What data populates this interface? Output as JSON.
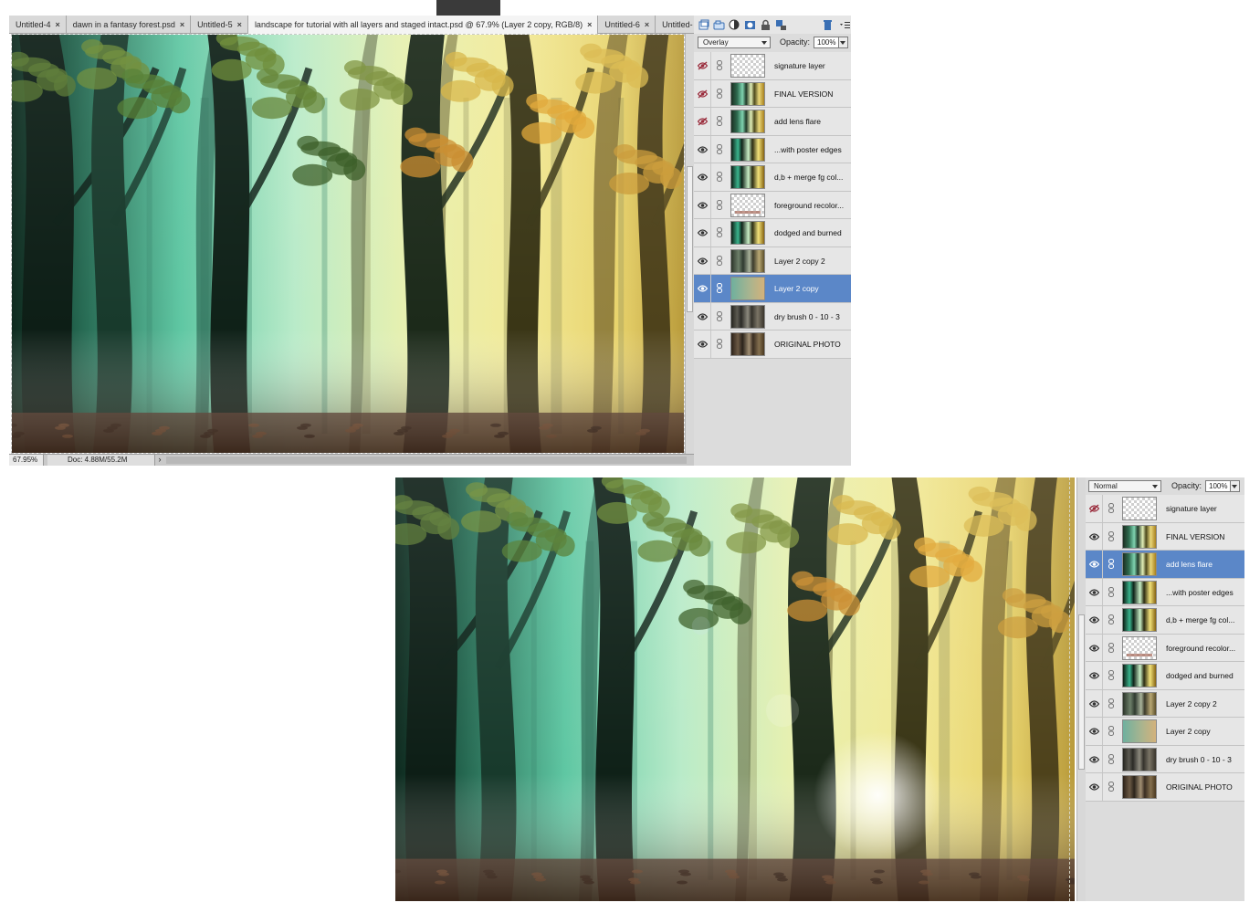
{
  "top_window": {
    "tabs": [
      {
        "label": "Untitled-4",
        "active": false,
        "closable": true
      },
      {
        "label": "dawn in a fantasy forest.psd",
        "active": false,
        "closable": true
      },
      {
        "label": "Untitled-5",
        "active": false,
        "closable": true
      },
      {
        "label": "landscape for tutorial with all layers and staged intact.psd @ 67.9% (Layer 2 copy, RGB/8)",
        "active": true,
        "closable": true
      },
      {
        "label": "Untitled-6",
        "active": false,
        "closable": true
      },
      {
        "label": "Untitled-",
        "active": false,
        "closable": false
      }
    ],
    "tab_overflow": "»",
    "close_glyph": "×",
    "status": {
      "zoom": "67.95%",
      "doc": "Doc: 4.88M/55.2M",
      "arrow": "›"
    },
    "image_brightness": 0.5,
    "layers_panel": {
      "blend_mode": "Overlay",
      "opacity_label": "Opacity:",
      "opacity_value": "100%",
      "toolbar_icons": [
        "new-layer-icon",
        "group-icon",
        "adjustment-icon",
        "mask-icon",
        "lock-icon",
        "lock-pixels-icon",
        "trash-icon",
        "panel-menu-icon"
      ],
      "layers": [
        {
          "name": "signature layer",
          "visible": false,
          "selected": false,
          "thumb": "check"
        },
        {
          "name": "FINAL VERSION",
          "visible": false,
          "selected": false,
          "thumb": "forest"
        },
        {
          "name": "add lens flare",
          "visible": false,
          "selected": false,
          "thumb": "forest"
        },
        {
          "name": "...with poster edges",
          "visible": true,
          "selected": false,
          "thumb": "poster"
        },
        {
          "name": "d,b + merge fg col...",
          "visible": true,
          "selected": false,
          "thumb": "poster"
        },
        {
          "name": "foreground recolor...",
          "visible": true,
          "selected": false,
          "thumb": "check-stain"
        },
        {
          "name": "dodged and burned",
          "visible": true,
          "selected": false,
          "thumb": "poster"
        },
        {
          "name": "Layer 2 copy 2",
          "visible": true,
          "selected": false,
          "thumb": "muted"
        },
        {
          "name": "Layer 2 copy",
          "visible": true,
          "selected": true,
          "thumb": "gradient"
        },
        {
          "name": "dry brush 0 - 10 - 3",
          "visible": true,
          "selected": false,
          "thumb": "gray"
        },
        {
          "name": "ORIGINAL PHOTO",
          "visible": true,
          "selected": false,
          "thumb": "sepia"
        }
      ]
    }
  },
  "bottom_window": {
    "image_brightness": 0.7,
    "lens_flare": true,
    "layers_panel": {
      "blend_mode": "Normal",
      "opacity_label": "Opacity:",
      "opacity_value": "100%",
      "layers": [
        {
          "name": "signature layer",
          "visible": false,
          "selected": false,
          "thumb": "check"
        },
        {
          "name": "FINAL VERSION",
          "visible": true,
          "selected": false,
          "thumb": "forest"
        },
        {
          "name": "add lens flare",
          "visible": true,
          "selected": true,
          "thumb": "forest"
        },
        {
          "name": "...with poster edges",
          "visible": true,
          "selected": false,
          "thumb": "poster"
        },
        {
          "name": "d,b + merge fg col...",
          "visible": true,
          "selected": false,
          "thumb": "poster"
        },
        {
          "name": "foreground recolor...",
          "visible": true,
          "selected": false,
          "thumb": "check-stain"
        },
        {
          "name": "dodged and burned",
          "visible": true,
          "selected": false,
          "thumb": "poster"
        },
        {
          "name": "Layer 2 copy 2",
          "visible": true,
          "selected": false,
          "thumb": "muted"
        },
        {
          "name": "Layer 2 copy",
          "visible": true,
          "selected": false,
          "thumb": "gradient"
        },
        {
          "name": "dry brush 0 - 10 - 3",
          "visible": true,
          "selected": false,
          "thumb": "gray"
        },
        {
          "name": "ORIGINAL PHOTO",
          "visible": true,
          "selected": false,
          "thumb": "sepia"
        }
      ]
    }
  },
  "colors": {
    "selection": "#5b87c8",
    "panel_bg": "#dcdcdc",
    "hidden_eye": "#9a2c3c"
  }
}
